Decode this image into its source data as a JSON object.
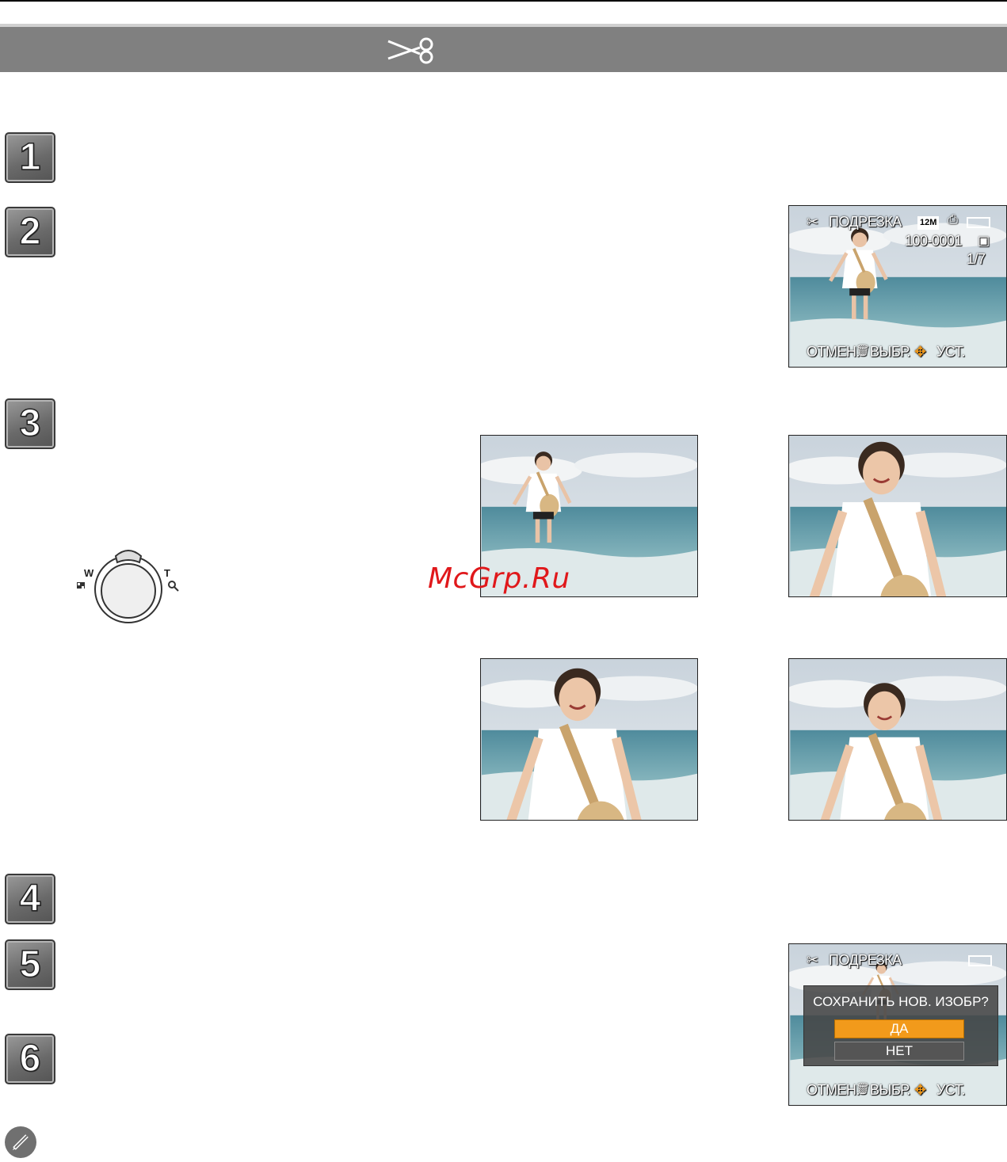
{
  "header": {
    "icon": "scissors-icon"
  },
  "steps": [
    "1",
    "2",
    "3",
    "4",
    "5",
    "6"
  ],
  "screen_step2": {
    "mode_label": "ПОДРЕЗКА",
    "size_badge": "12M",
    "file_number": "100-0001",
    "counter": "1/7",
    "footer": {
      "cancel": "ОТМЕН.",
      "select": "ВЫБР.",
      "set": "УСТ."
    }
  },
  "zoom_lever": {
    "wide_label": "W",
    "tele_label": "T"
  },
  "watermark": "McGrp.Ru",
  "screen_step5": {
    "mode_label": "ПОДРЕЗКА",
    "dialog": {
      "question": "СОХРАНИТЬ НОВ. ИЗОБР?",
      "yes": "ДА",
      "no": "НЕТ"
    },
    "footer": {
      "cancel": "ОТМЕН.",
      "select": "ВЫБР.",
      "set": "УСТ."
    }
  },
  "colors": {
    "header_bar": "#808080",
    "highlight": "#f29a1b",
    "watermark": "#e0181b"
  }
}
